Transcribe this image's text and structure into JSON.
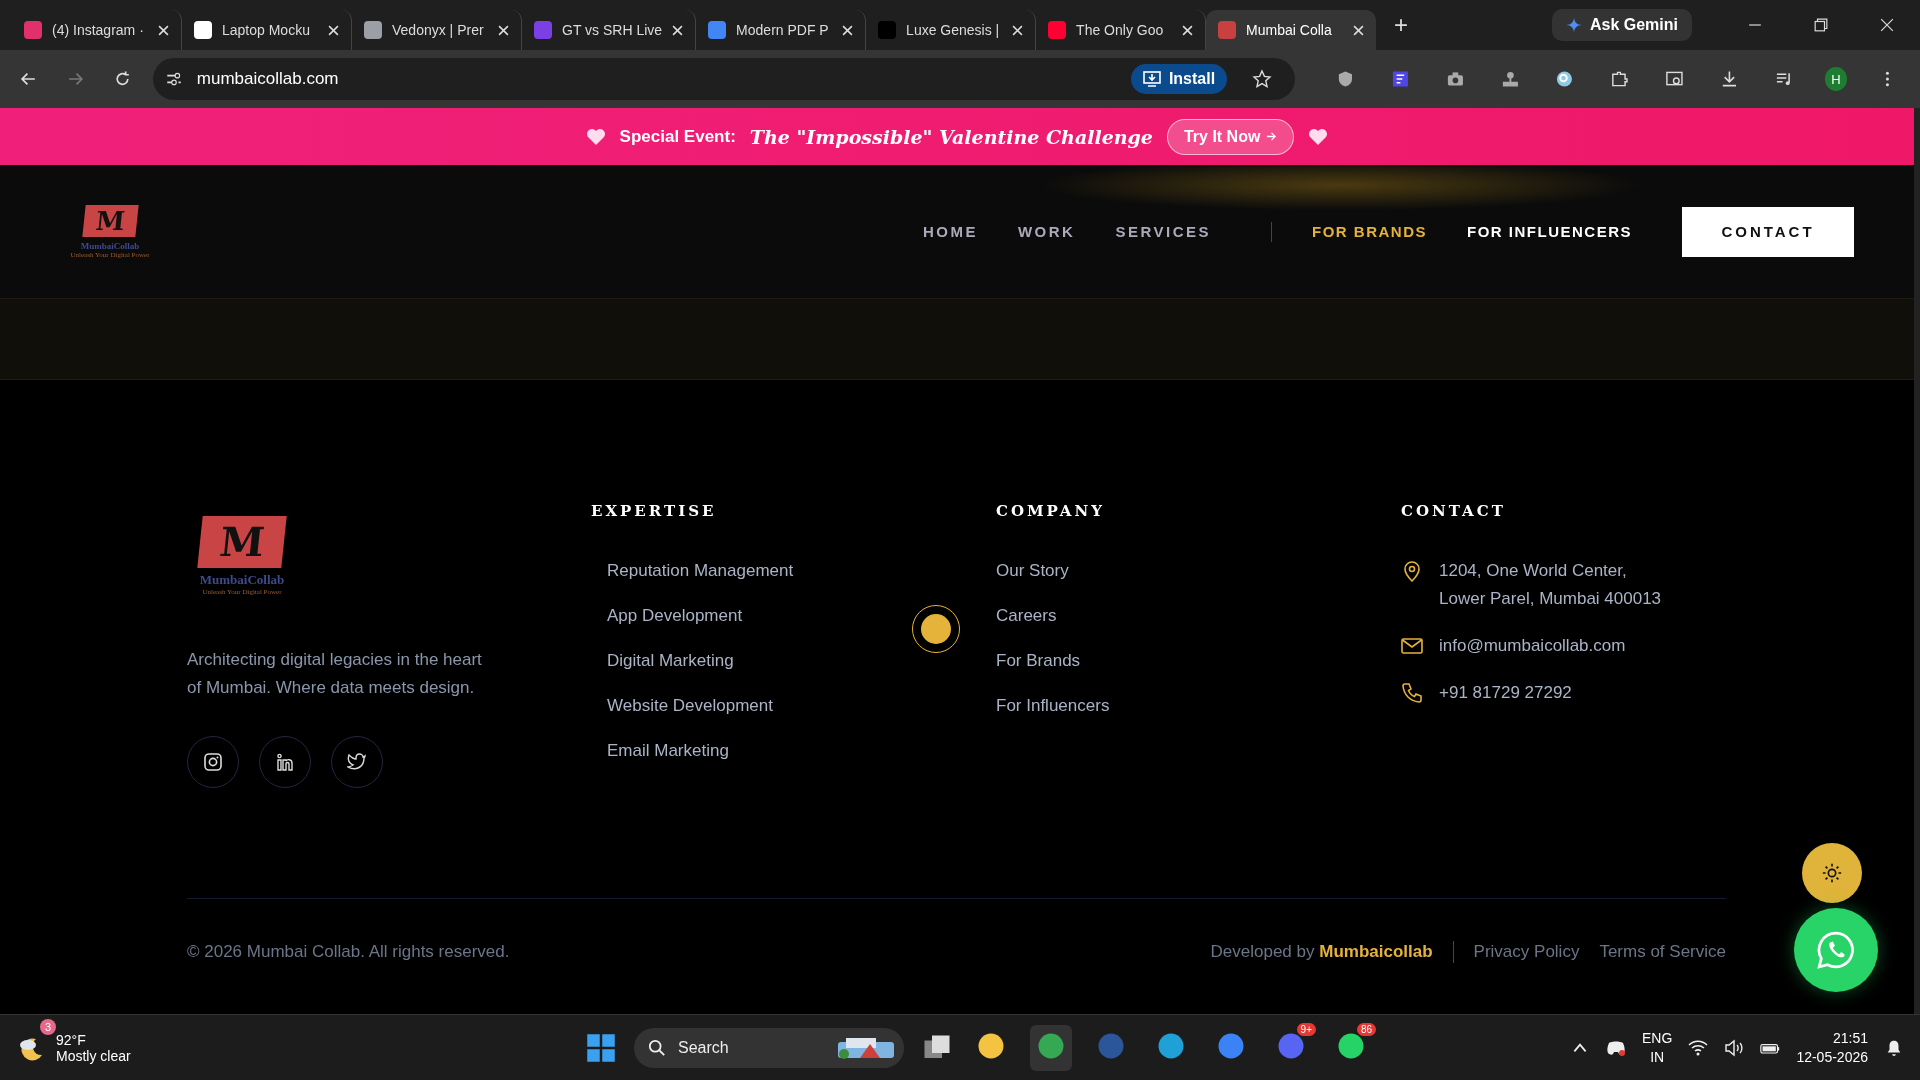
{
  "browser": {
    "tabs": [
      {
        "title": "(4) Instagram ·",
        "selected": false,
        "color": "#e1306c"
      },
      {
        "title": "Laptop Mocku",
        "selected": false,
        "color": "#ffffff"
      },
      {
        "title": "Vedonyx | Prer",
        "selected": false,
        "color": "#9aa0a6"
      },
      {
        "title": "GT vs SRH Live",
        "selected": false,
        "color": "#7b3fe4"
      },
      {
        "title": "Modern PDF P",
        "selected": false,
        "color": "#4285f4"
      },
      {
        "title": "Luxe Genesis |",
        "selected": false,
        "color": "#000000"
      },
      {
        "title": "The Only Goo",
        "selected": false,
        "color": "#ff0033"
      },
      {
        "title": "Mumbai Colla",
        "selected": true,
        "color": "#c94040"
      }
    ],
    "new_tab": "+",
    "ask_gemini": "Ask Gemini",
    "url": "mumbaicollab.com",
    "install": "Install",
    "profile": "H"
  },
  "banner": {
    "label": "Special Event:",
    "title": "The \"Impossible\" Valentine Challenge",
    "button": "Try It Now"
  },
  "nav": {
    "logo": {
      "letter": "M",
      "name": "MumbaiCollab",
      "tagline": "Unleash Your Digital Power"
    },
    "links": [
      "HOME",
      "WORK",
      "SERVICES"
    ],
    "audience_links": [
      {
        "label": "FOR BRANDS",
        "selected": true
      },
      {
        "label": "FOR INFLUENCERS",
        "selected": false
      }
    ],
    "contact_button": "CONTACT"
  },
  "footer": {
    "logo": {
      "letter": "M",
      "name": "MumbaiCollab",
      "tagline": "Unleash Your Digital Power"
    },
    "about": "Architecting digital legacies in the heart of Mumbai. Where data meets design.",
    "columns": [
      {
        "heading": "EXPERTISE",
        "items": [
          "Reputation Management",
          "App Development",
          "Digital Marketing",
          "Website Development",
          "Email Marketing"
        ]
      },
      {
        "heading": "COMPANY",
        "items": [
          "Our Story",
          "Careers",
          "For Brands",
          "For Influencers"
        ]
      }
    ],
    "contact": {
      "heading": "CONTACT",
      "items": [
        {
          "kind": "address",
          "lines": [
            "1204, One World Center,",
            "Lower Parel, Mumbai 400013"
          ]
        },
        {
          "kind": "email",
          "lines": [
            "info@mumbaicollab.com"
          ]
        },
        {
          "kind": "phone",
          "lines": [
            "+91 81729 27292"
          ]
        }
      ]
    },
    "copyright": "© 2026 Mumbai Collab. All rights reserved.",
    "developed_by": "Developed by",
    "developer": "Mumbaicollab",
    "legal_links": [
      "Privacy Policy",
      "Terms of Service"
    ]
  },
  "taskbar": {
    "weather": {
      "temp": "92°F",
      "condition": "Mostly clear",
      "badge": "3"
    },
    "search": "Search",
    "apps": [
      {
        "kind": "files"
      },
      {
        "kind": "chrome"
      },
      {
        "kind": "word"
      },
      {
        "kind": "edge"
      },
      {
        "kind": "arrow"
      },
      {
        "kind": "discord",
        "badge": "9+"
      },
      {
        "kind": "whatsapp",
        "badge": "86"
      }
    ],
    "language": [
      "ENG",
      "IN"
    ],
    "time": "21:51",
    "date": "12-05-2026"
  }
}
